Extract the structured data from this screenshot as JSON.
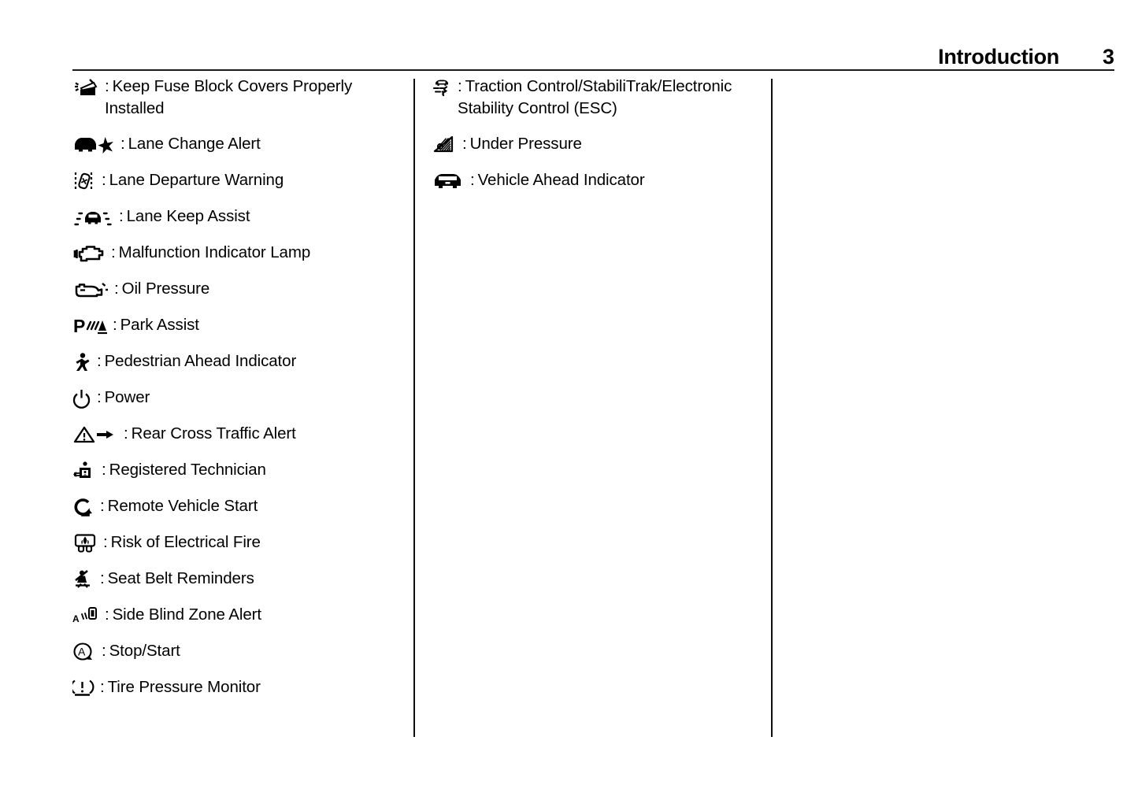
{
  "header": {
    "title": "Introduction",
    "page_number": "3"
  },
  "columns": [
    {
      "id": "column-1",
      "items": [
        {
          "icon": "keep-fuse-block-covers-icon",
          "separator": ":",
          "label": "Keep Fuse Block Covers Properly Installed"
        },
        {
          "icon": "lane-change-alert-icon",
          "separator": ":",
          "label": "Lane Change Alert"
        },
        {
          "icon": "lane-departure-warning-icon",
          "separator": ":",
          "label": "Lane Departure Warning"
        },
        {
          "icon": "lane-keep-assist-icon",
          "separator": ":",
          "label": "Lane Keep Assist"
        },
        {
          "icon": "malfunction-indicator-lamp-icon",
          "separator": ":",
          "label": "Malfunction Indicator Lamp"
        },
        {
          "icon": "oil-pressure-icon",
          "separator": ":",
          "label": "Oil Pressure"
        },
        {
          "icon": "park-assist-icon",
          "separator": ":",
          "label": "Park Assist"
        },
        {
          "icon": "pedestrian-ahead-indicator-icon",
          "separator": ":",
          "label": "Pedestrian Ahead Indicator"
        },
        {
          "icon": "power-icon",
          "separator": ":",
          "label": "Power"
        },
        {
          "icon": "rear-cross-traffic-alert-icon",
          "separator": ":",
          "label": "Rear Cross Traffic Alert"
        },
        {
          "icon": "registered-technician-icon",
          "separator": ":",
          "label": "Registered Technician"
        },
        {
          "icon": "remote-vehicle-start-icon",
          "separator": ":",
          "label": "Remote Vehicle Start"
        },
        {
          "icon": "risk-of-electrical-fire-icon",
          "separator": ":",
          "label": "Risk of Electrical Fire"
        },
        {
          "icon": "seat-belt-reminders-icon",
          "separator": ":",
          "label": "Seat Belt Reminders"
        },
        {
          "icon": "side-blind-zone-alert-icon",
          "separator": ":",
          "label": "Side Blind Zone Alert"
        },
        {
          "icon": "stop-start-icon",
          "separator": ":",
          "label": "Stop/Start"
        },
        {
          "icon": "tire-pressure-monitor-icon",
          "separator": ":",
          "label": "Tire Pressure Monitor"
        }
      ]
    },
    {
      "id": "column-2",
      "items": [
        {
          "icon": "traction-control-icon",
          "separator": ":",
          "label": "Traction Control/StabiliTrak/Electronic Stability Control (ESC)"
        },
        {
          "icon": "under-pressure-icon",
          "separator": ":",
          "label": "Under Pressure"
        },
        {
          "icon": "vehicle-ahead-indicator-icon",
          "separator": ":",
          "label": "Vehicle Ahead Indicator"
        }
      ]
    },
    {
      "id": "column-3",
      "items": []
    }
  ]
}
